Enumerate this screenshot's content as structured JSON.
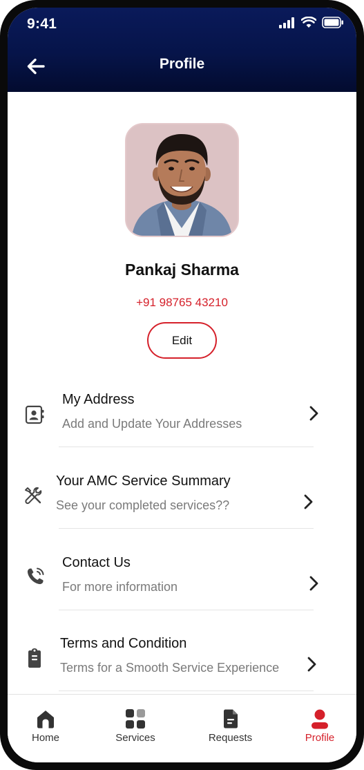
{
  "status_bar": {
    "time": "9:41"
  },
  "header": {
    "title": "Profile"
  },
  "profile": {
    "name": "Pankaj Sharma",
    "phone": "+91 98765 43210",
    "edit_label": "Edit"
  },
  "menu": [
    {
      "title": "My Address",
      "subtitle": "Add and Update Your Addresses",
      "icon": "address-book-icon"
    },
    {
      "title": "Your AMC Service Summary",
      "subtitle": "See your completed services??",
      "icon": "tools-icon"
    },
    {
      "title": "Contact Us",
      "subtitle": "For more information",
      "icon": "phone-call-icon"
    },
    {
      "title": "Terms and Condition",
      "subtitle": "Terms for a Smooth Service Experience",
      "icon": "clipboard-icon"
    }
  ],
  "bottom_nav": [
    {
      "label": "Home",
      "icon": "home-icon",
      "active": false
    },
    {
      "label": "Services",
      "icon": "services-grid-icon",
      "active": false
    },
    {
      "label": "Requests",
      "icon": "document-icon",
      "active": false
    },
    {
      "label": "Profile",
      "icon": "user-icon",
      "active": true
    }
  ],
  "colors": {
    "header_top": "#0a1a5a",
    "header_bottom": "#030b2f",
    "accent": "#d5202a",
    "text_primary": "#111111",
    "text_secondary": "#7a7a7a"
  }
}
